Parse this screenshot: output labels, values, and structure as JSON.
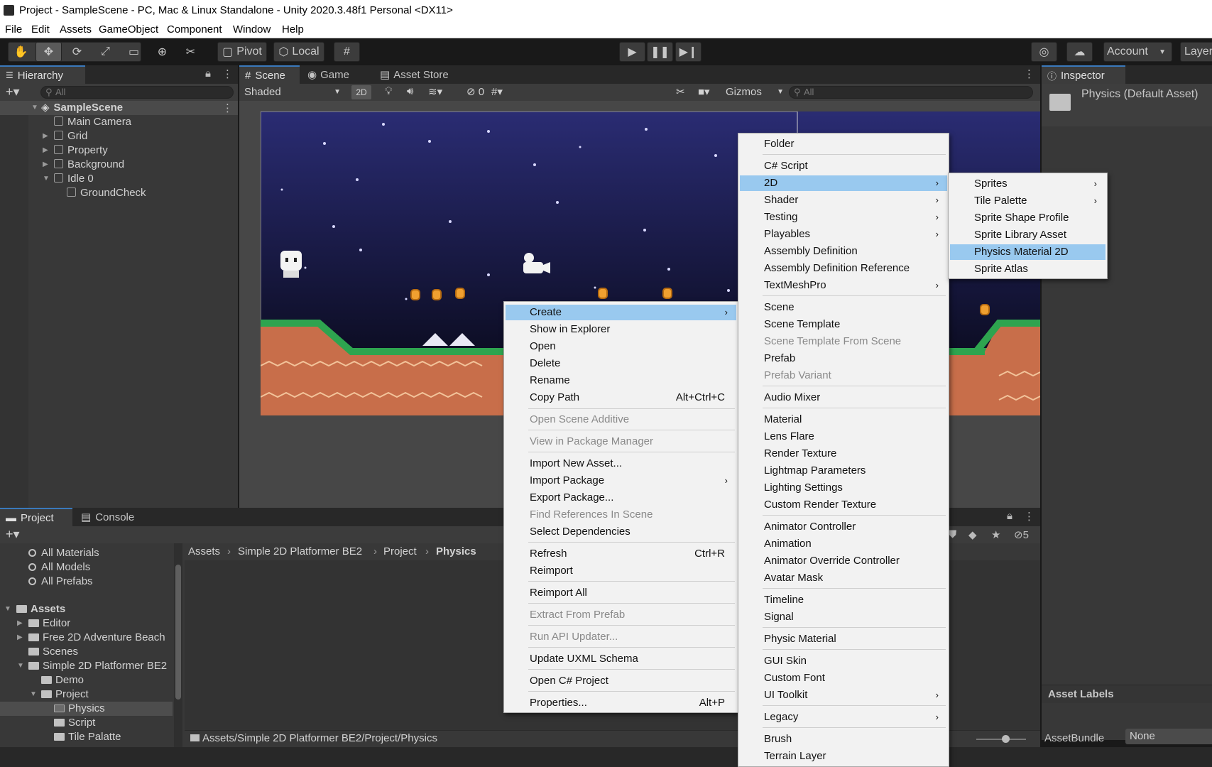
{
  "window": {
    "title": "Project - SampleScene - PC, Mac & Linux Standalone - Unity 2020.3.48f1 Personal <DX11>"
  },
  "menubar": [
    "File",
    "Edit",
    "Assets",
    "GameObject",
    "Component",
    "Window",
    "Help"
  ],
  "toolbar": {
    "pivot": "Pivot",
    "local": "Local",
    "account": "Account",
    "layers": "Layer"
  },
  "hierarchy": {
    "tab": "Hierarchy",
    "search_placeholder": "All",
    "scene": "SampleScene",
    "items": [
      "Main Camera",
      "Grid",
      "Property",
      "Background",
      "Idle 0",
      "GroundCheck"
    ]
  },
  "scene_tabs": {
    "scene": "Scene",
    "game": "Game",
    "asset_store": "Asset Store"
  },
  "scene_toolbar": {
    "shading": "Shaded",
    "mode_2d": "2D",
    "hidden_count": "0",
    "gizmos": "Gizmos",
    "search_placeholder": "All"
  },
  "inspector": {
    "tab": "Inspector",
    "asset": "Physics (Default Asset)",
    "asset_labels": "Asset Labels",
    "assetbundle_label": "AssetBundle",
    "assetbundle_value": "None"
  },
  "project": {
    "tab": "Project",
    "console_tab": "Console",
    "hidden_count": "5",
    "favorites": [
      "All Materials",
      "All Models",
      "All Prefabs"
    ],
    "assets_root": "Assets",
    "tree": [
      "Editor",
      "Free 2D Adventure Beach",
      "Scenes",
      "Simple 2D Platformer BE2",
      "Demo",
      "Project",
      "Physics",
      "Script",
      "Tile Palatte"
    ],
    "breadcrumb": [
      "Assets",
      "Simple 2D Platformer BE2",
      "Project",
      "Physics"
    ],
    "path": "Assets/Simple 2D Platformer BE2/Project/Physics"
  },
  "context_menu": {
    "items": [
      {
        "label": "Create",
        "submenu": true,
        "highlighted": true
      },
      {
        "label": "Show in Explorer"
      },
      {
        "label": "Open"
      },
      {
        "label": "Delete"
      },
      {
        "label": "Rename"
      },
      {
        "label": "Copy Path",
        "shortcut": "Alt+Ctrl+C"
      },
      {
        "label": "Open Scene Additive",
        "disabled": true
      },
      {
        "label": "View in Package Manager",
        "disabled": true
      },
      {
        "label": "Import New Asset..."
      },
      {
        "label": "Import Package",
        "submenu": true
      },
      {
        "label": "Export Package..."
      },
      {
        "label": "Find References In Scene",
        "disabled": true
      },
      {
        "label": "Select Dependencies"
      },
      {
        "label": "Refresh",
        "shortcut": "Ctrl+R"
      },
      {
        "label": "Reimport"
      },
      {
        "label": "Reimport All"
      },
      {
        "label": "Extract From Prefab",
        "disabled": true
      },
      {
        "label": "Run API Updater...",
        "disabled": true
      },
      {
        "label": "Update UXML Schema"
      },
      {
        "label": "Open C# Project"
      },
      {
        "label": "Properties...",
        "shortcut": "Alt+P"
      }
    ]
  },
  "create_menu": {
    "items": [
      {
        "label": "Folder"
      },
      {
        "label": "C# Script"
      },
      {
        "label": "2D",
        "submenu": true,
        "highlighted": true
      },
      {
        "label": "Shader",
        "submenu": true
      },
      {
        "label": "Testing",
        "submenu": true
      },
      {
        "label": "Playables",
        "submenu": true
      },
      {
        "label": "Assembly Definition"
      },
      {
        "label": "Assembly Definition Reference"
      },
      {
        "label": "TextMeshPro",
        "submenu": true
      },
      {
        "label": "Scene"
      },
      {
        "label": "Scene Template"
      },
      {
        "label": "Scene Template From Scene",
        "disabled": true
      },
      {
        "label": "Prefab"
      },
      {
        "label": "Prefab Variant",
        "disabled": true
      },
      {
        "label": "Audio Mixer"
      },
      {
        "label": "Material"
      },
      {
        "label": "Lens Flare"
      },
      {
        "label": "Render Texture"
      },
      {
        "label": "Lightmap Parameters"
      },
      {
        "label": "Lighting Settings"
      },
      {
        "label": "Custom Render Texture"
      },
      {
        "label": "Animator Controller"
      },
      {
        "label": "Animation"
      },
      {
        "label": "Animator Override Controller"
      },
      {
        "label": "Avatar Mask"
      },
      {
        "label": "Timeline"
      },
      {
        "label": "Signal"
      },
      {
        "label": "Physic Material"
      },
      {
        "label": "GUI Skin"
      },
      {
        "label": "Custom Font"
      },
      {
        "label": "UI Toolkit",
        "submenu": true
      },
      {
        "label": "Legacy",
        "submenu": true
      },
      {
        "label": "Brush"
      },
      {
        "label": "Terrain Layer"
      }
    ]
  },
  "submenu_2d": {
    "items": [
      {
        "label": "Sprites",
        "submenu": true
      },
      {
        "label": "Tile Palette",
        "submenu": true
      },
      {
        "label": "Sprite Shape Profile"
      },
      {
        "label": "Sprite Library Asset"
      },
      {
        "label": "Physics Material 2D",
        "highlighted": true
      },
      {
        "label": "Sprite Atlas"
      }
    ]
  }
}
